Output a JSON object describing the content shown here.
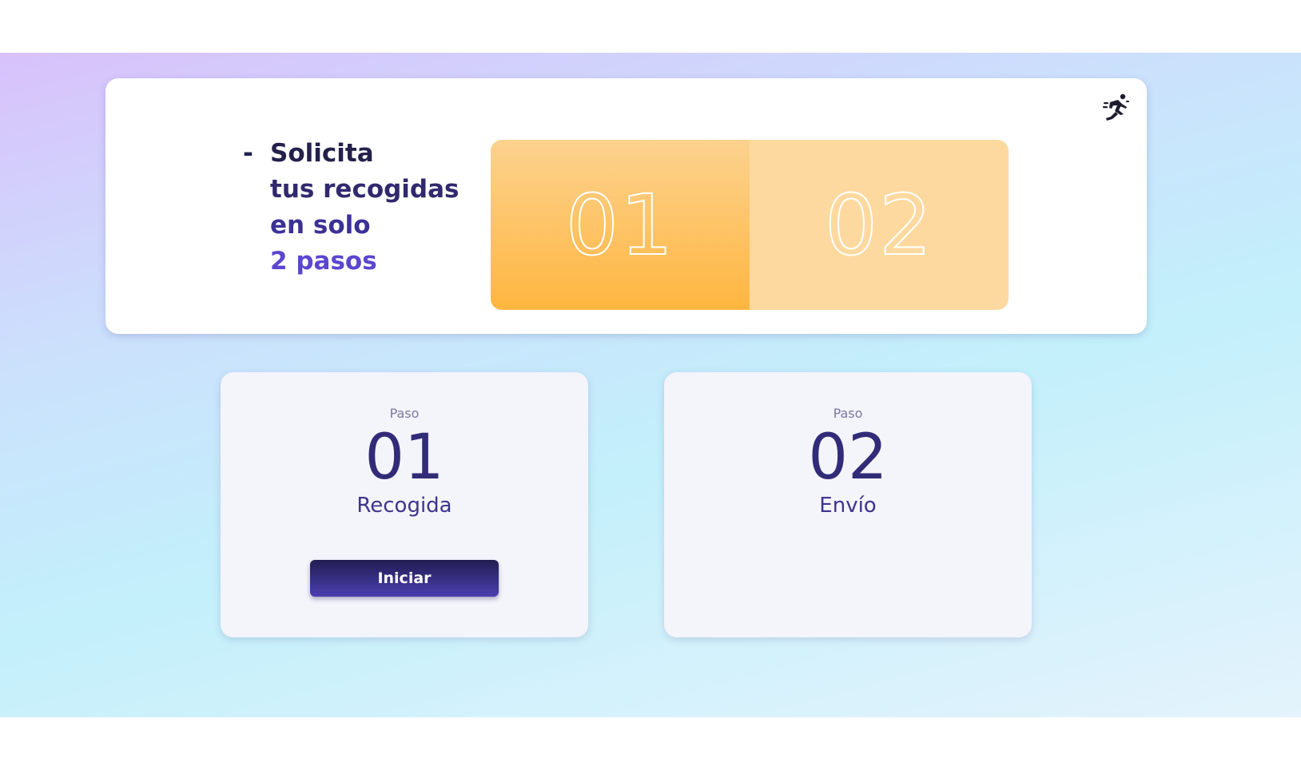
{
  "hero": {
    "dash": "-",
    "title_line1": "Solicita",
    "title_line2": "tus recogidas",
    "title_line3": "en solo",
    "title_line4": "2 pasos",
    "icon": "runner-icon"
  },
  "banner": {
    "steps": [
      "01",
      "02"
    ],
    "active_index": 0
  },
  "steps": [
    {
      "label": "Paso",
      "number": "01",
      "name": "Recogida",
      "button_label": "Iniciar"
    },
    {
      "label": "Paso",
      "number": "02",
      "name": "Envío"
    }
  ],
  "colors": {
    "accent_orange": "#ffb640",
    "accent_orange_light": "#fed99f",
    "brand_dark": "#23214a",
    "brand_purple": "#5b46cf",
    "button_gradient_top": "#221d52",
    "button_gradient_bottom": "#4a3fb0"
  }
}
